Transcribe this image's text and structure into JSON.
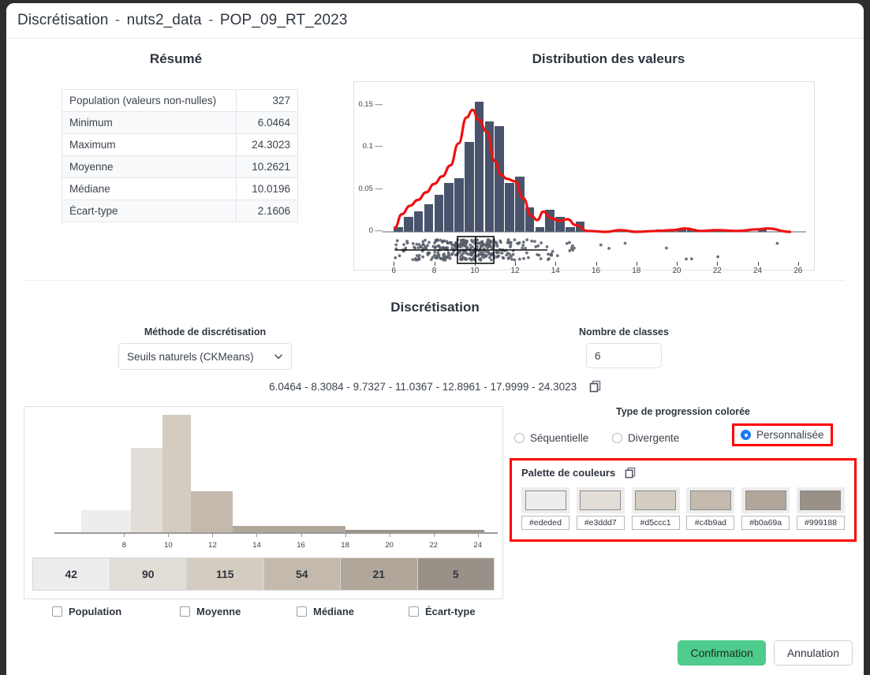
{
  "window": {
    "title_main": "Discrétisation",
    "title_sep1": "-",
    "title_dataset": "nuts2_data",
    "title_sep2": "-",
    "title_field": "POP_09_RT_2023"
  },
  "resume": {
    "heading": "Résumé",
    "rows": [
      {
        "label": "Population (valeurs non-nulles)",
        "value": "327"
      },
      {
        "label": "Minimum",
        "value": "6.0464"
      },
      {
        "label": "Maximum",
        "value": "24.3023"
      },
      {
        "label": "Moyenne",
        "value": "10.2621"
      },
      {
        "label": "Médiane",
        "value": "10.0196"
      },
      {
        "label": "Écart-type",
        "value": "2.1606"
      }
    ]
  },
  "distribution": {
    "heading": "Distribution des valeurs"
  },
  "discretisation": {
    "section_title": "Discrétisation",
    "method_label": "Méthode de discrétisation",
    "method_value": "Seuils naturels (CKMeans)",
    "classes_label": "Nombre de classes",
    "classes_value": "6",
    "thresholds_text": "6.0464 - 8.3084 - 9.7327 - 11.0367 - 12.8961 - 17.9999 - 24.3023",
    "copy_icon": "copy-icon"
  },
  "progression": {
    "title": "Type de progression colorée",
    "options": [
      {
        "label": "Séquentielle",
        "selected": false
      },
      {
        "label": "Divergente",
        "selected": false
      },
      {
        "label": "Personnalisée",
        "selected": true
      }
    ]
  },
  "palette": {
    "title": "Palette de couleurs",
    "copy_icon": "copy-icon",
    "colors": [
      "#ededed",
      "#e3ddd7",
      "#d5ccc1",
      "#c4b9ad",
      "#b0a69a",
      "#999188"
    ]
  },
  "stats_checkboxes": [
    {
      "label": "Population",
      "checked": false
    },
    {
      "label": "Moyenne",
      "checked": false
    },
    {
      "label": "Médiane",
      "checked": false
    },
    {
      "label": "Écart-type",
      "checked": false
    }
  ],
  "footer": {
    "confirm_label": "Confirmation",
    "cancel_label": "Annulation",
    "confirm_color": "#4ecb8d"
  },
  "chart_data": [
    {
      "type": "histogram",
      "name": "distribution-des-valeurs",
      "title": "Distribution des valeurs",
      "xlabel": "",
      "ylabel": "",
      "xlim": [
        5.6,
        26.4
      ],
      "ylim": [
        0,
        0.165
      ],
      "yticks": [
        0,
        0.05,
        0.1,
        0.15
      ],
      "ytick_labels": [
        "0",
        "0.05",
        "0.1",
        "0.15"
      ],
      "xticks": [
        6,
        8,
        10,
        12,
        14,
        16,
        18,
        20,
        22,
        24,
        26
      ],
      "xtick_labels": [
        "6",
        "8",
        "10",
        "12",
        "14",
        "16",
        "18",
        "20",
        "22",
        "24",
        "26"
      ],
      "bin_width": 0.5,
      "bin_starts": [
        6.0,
        6.5,
        7.0,
        7.5,
        8.0,
        8.5,
        9.0,
        9.5,
        10.0,
        10.5,
        11.0,
        11.5,
        12.0,
        12.5,
        13.0,
        13.5,
        14.0,
        14.5,
        15.0,
        15.5,
        16.0,
        16.5,
        17.0,
        17.5,
        18.0,
        18.5,
        19.0,
        19.5,
        20.0,
        20.5,
        21.0,
        21.5,
        22.0,
        22.5,
        23.0,
        23.5,
        24.0
      ],
      "values": [
        0.006,
        0.018,
        0.024,
        0.033,
        0.044,
        0.058,
        0.064,
        0.107,
        0.155,
        0.131,
        0.126,
        0.058,
        0.066,
        0.029,
        0.006,
        0.026,
        0.018,
        0.006,
        0.012,
        0.0,
        0.0,
        0.0,
        0.003,
        0.0,
        0.0,
        0.0,
        0.003,
        0.0,
        0.003,
        0.004,
        0.0,
        0.0,
        0.003,
        0.0,
        0.0,
        0.0,
        0.004
      ],
      "density_curve": {
        "color": "#ee1111",
        "x": [
          6.05,
          6.4,
          6.8,
          7.2,
          7.6,
          8.0,
          8.4,
          8.8,
          9.2,
          9.6,
          9.9,
          10.2,
          10.6,
          11.0,
          11.3,
          11.6,
          12.0,
          12.4,
          12.8,
          13.1,
          13.4,
          13.8,
          14.2,
          14.6,
          15.0,
          15.6,
          16.5,
          17.2,
          18.0,
          19.0,
          19.8,
          20.4,
          21.2,
          22.0,
          23.0,
          24.0,
          24.5,
          25.6
        ],
        "y": [
          0.005,
          0.021,
          0.031,
          0.038,
          0.047,
          0.057,
          0.066,
          0.079,
          0.105,
          0.136,
          0.145,
          0.133,
          0.119,
          0.084,
          0.068,
          0.063,
          0.06,
          0.04,
          0.019,
          0.014,
          0.024,
          0.016,
          0.013,
          0.015,
          0.008,
          0.001,
          0.0,
          0.002,
          0.0,
          0.001,
          0.002,
          0.004,
          0.001,
          0.002,
          0.001,
          0.003,
          0.004,
          0.0
        ]
      },
      "boxplot": {
        "min": 6.05,
        "q1": 9.15,
        "median": 10.05,
        "q3": 10.95,
        "max": 13.6,
        "has_jitter_points": true
      },
      "bar_color": "#49536b",
      "grid": false
    },
    {
      "type": "bar",
      "name": "classes-preview-histogram",
      "title": "",
      "xlim": [
        6.0464,
        24.3023
      ],
      "xticks": [
        8,
        10,
        12,
        14,
        16,
        18,
        20,
        22,
        24
      ],
      "xtick_labels": [
        "8",
        "10",
        "12",
        "14",
        "16",
        "18",
        "20",
        "22",
        "24"
      ],
      "class_breaks": [
        6.0464,
        8.3084,
        9.7327,
        11.0367,
        12.8961,
        17.9999,
        24.3023
      ],
      "counts": [
        42,
        90,
        115,
        54,
        21,
        5
      ],
      "densities": [
        0.1857,
        0.7023,
        0.9815,
        0.3414,
        0.05,
        0.0014
      ],
      "colors": [
        "#ededed",
        "#e3ddd7",
        "#d5ccc1",
        "#c4b9ad",
        "#b0a69a",
        "#999188"
      ],
      "ylabel": "",
      "grid": false
    },
    {
      "type": "table",
      "name": "class-counts-bar",
      "categories": [
        "6.0464 - 8.3084",
        "8.3084 - 9.7327",
        "9.7327 - 11.0367",
        "11.0367 - 12.8961",
        "12.8961 - 17.9999",
        "17.9999 - 24.3023"
      ],
      "values": [
        42,
        90,
        115,
        54,
        21,
        5
      ],
      "colors": [
        "#ededed",
        "#e3ddd7",
        "#d5ccc1",
        "#c4b9ad",
        "#b0a69a",
        "#999188"
      ]
    }
  ]
}
